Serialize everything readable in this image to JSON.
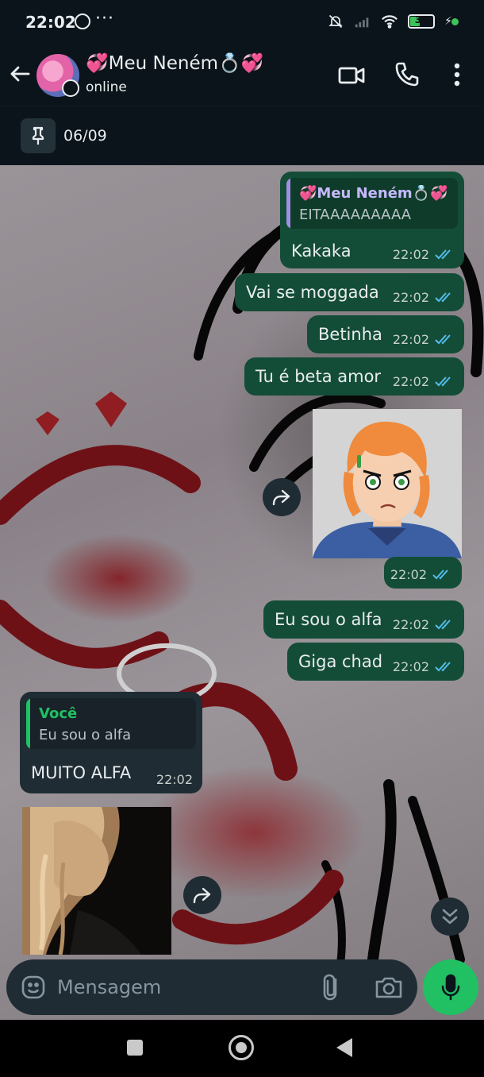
{
  "status_bar": {
    "time": "22:02",
    "overflow": "···",
    "battery": "38",
    "charging": "⚡",
    "icons": [
      "whatsapp-icon",
      "mute-icon",
      "signal-icon",
      "wifi-icon",
      "battery-icon",
      "charging-icon"
    ]
  },
  "header": {
    "contact_name": "💞Meu Neném💍💞",
    "status": "online",
    "icons": [
      "back-arrow-icon",
      "video-call-icon",
      "phone-icon",
      "more-vert-icon"
    ]
  },
  "pinned": {
    "text": "06/09",
    "icon": "pin-icon"
  },
  "messages": [
    {
      "direction": "out",
      "type": "reply",
      "quote_author": "💞Meu Neném💍💞",
      "quote_text": "EITAAAAAAAAA",
      "text": "Kakaka",
      "time": "22:02",
      "read": true
    },
    {
      "direction": "out",
      "type": "text",
      "text": "Vai se moggada",
      "time": "22:02",
      "read": true
    },
    {
      "direction": "out",
      "type": "text",
      "text": "Betinha",
      "time": "22:02",
      "read": true
    },
    {
      "direction": "out",
      "type": "text",
      "text": "Tu é beta amor",
      "time": "22:02",
      "read": true
    },
    {
      "direction": "out",
      "type": "image",
      "image_desc": "cartoon-orange-hair",
      "time": "22:02",
      "read": true
    },
    {
      "direction": "out",
      "type": "text",
      "text": "Eu sou o alfa",
      "time": "22:02",
      "read": true
    },
    {
      "direction": "out",
      "type": "text",
      "text": "Giga chad",
      "time": "22:02",
      "read": true
    },
    {
      "direction": "in",
      "type": "reply",
      "quote_author": "Você",
      "quote_text": "Eu sou o alfa",
      "text": "MUITO ALFA",
      "time": "22:02"
    },
    {
      "direction": "in",
      "type": "image",
      "image_desc": "blonde-hair-photo"
    }
  ],
  "composer": {
    "placeholder": "Mensagem",
    "icons": [
      "emoji-icon",
      "attach-icon",
      "camera-icon",
      "mic-icon"
    ]
  },
  "colors": {
    "outgoing_bubble": "#144d37",
    "incoming_bubble": "#1f2c34",
    "accent_green": "#21c063",
    "read_ticks": "#53bdeb",
    "quote_bar_in_reply": "#9f8fe6",
    "quote_bar_self": "#21c063"
  }
}
